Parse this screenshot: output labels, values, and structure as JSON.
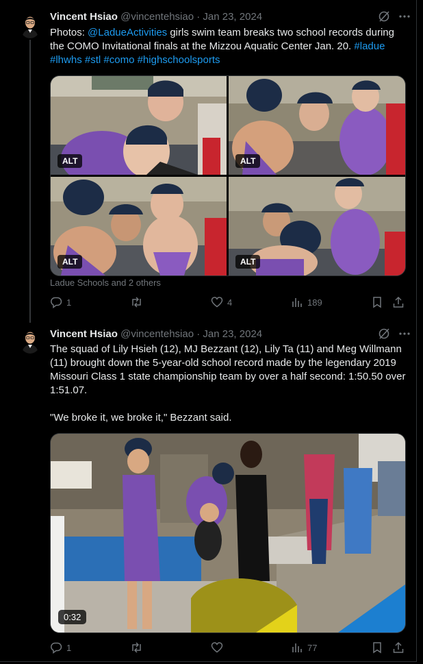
{
  "tweet1": {
    "name": "Vincent Hsiao",
    "handle": "@vincentehsiao",
    "date": "· Jan 23, 2024",
    "text_before_mention": "Photos: ",
    "mention": "@LadueActivities",
    "text_after_mention": " girls swim team breaks two school records during the COMO Invitational finals at the Mizzou Aquatic Center Jan. 20. ",
    "hashtags": [
      "#ladue",
      "#lhwhs",
      "#stl",
      "#como",
      "#highschoolsports"
    ],
    "photos": [
      {
        "alt_badge": "ALT",
        "icon": "photo-swimmers-cheering"
      },
      {
        "alt_badge": "ALT",
        "icon": "photo-swimmers-celebrating"
      },
      {
        "alt_badge": "ALT",
        "icon": "photo-swimmers-shouting"
      },
      {
        "alt_badge": "ALT",
        "icon": "photo-swimmers-embracing"
      }
    ],
    "tagged": "Ladue Schools and 2 others",
    "replies": "1",
    "reposts": "",
    "likes": "4",
    "views": "189"
  },
  "tweet2": {
    "name": "Vincent Hsiao",
    "handle": "@vincentehsiao",
    "date": "· Jan 23, 2024",
    "text_p1": "The squad of Lily Hsieh (12), MJ Bezzant (12), Lily Ta (11) and Meg Willmann (11) brought down the 5-year-old school record made by the legendary 2019 Missouri Class 1 state championship team by over a half second: 1:50.50 over 1:51.07.",
    "text_p2": "\"We broke it, we broke it,\" Bezzant said.",
    "video_duration": "0:32",
    "replies": "1",
    "reposts": "",
    "likes": "",
    "views": "77"
  },
  "colors": {
    "background": "#000000",
    "text": "#e7e9ea",
    "muted": "#71767b",
    "link": "#1d9bf0",
    "swimsuit": "#7a4fb0"
  }
}
